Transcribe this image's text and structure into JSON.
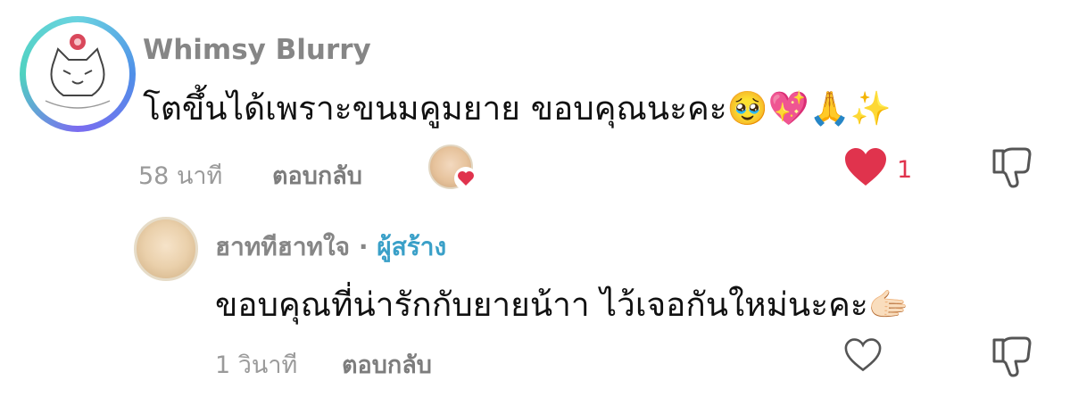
{
  "comment": {
    "author": "Whimsy Blurry",
    "text": "โตขึ้นได้เพราะขนมคูมยาย ขอบคุณนะคะ🥹💖🙏✨",
    "time": "58 นาที",
    "reply_label": "ตอบกลับ",
    "like_count": "1"
  },
  "reply": {
    "author": "ฮาททีฮาทใจ",
    "separator": "·",
    "creator_badge": "ผู้สร้าง",
    "text": "ขอบคุณที่น่ารักกับยายน้าา ไว้เจอกันใหม่นะคะ🫱🏻",
    "time": "1 วินาที",
    "reply_label": "ตอบกลับ"
  },
  "colors": {
    "like_red": "#e0334d",
    "creator_blue": "#3aa0c8"
  },
  "icons": [
    "heart-filled-icon",
    "heart-outline-icon",
    "thumbs-down-icon",
    "creator-liked-heart-icon"
  ]
}
